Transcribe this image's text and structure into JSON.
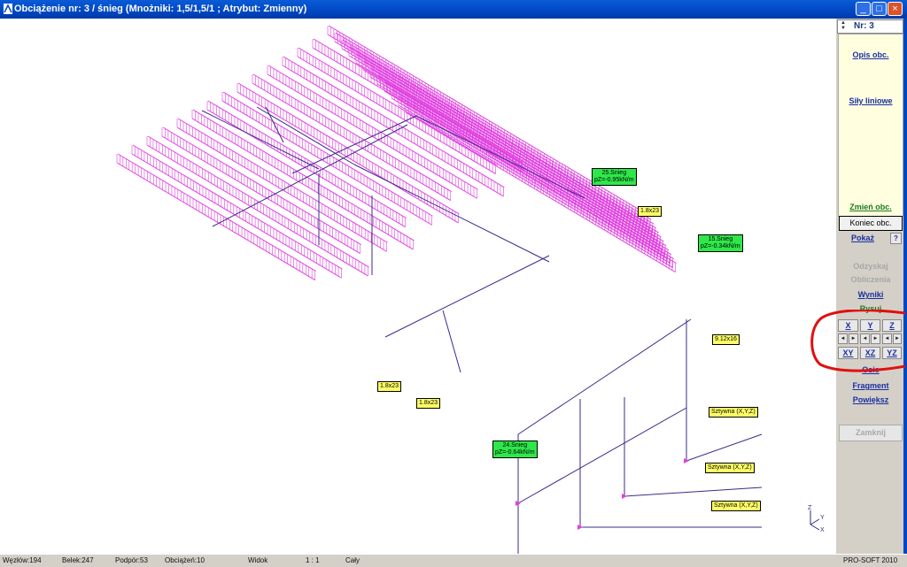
{
  "window": {
    "title": "Obciążenie nr: 3 / śnieg (Mnożniki: 1,5/1,5/1 ; Atrybut: Zmienny)",
    "buttons": {
      "minimize": "_",
      "maximize": "□",
      "close": "×"
    }
  },
  "panel": {
    "nr_label": "Nr: 3",
    "spin": {
      "up": "▲",
      "down": "▼"
    },
    "opis_obc": "Opis obc.",
    "sily_liniowe": "Siły liniowe",
    "zmien_obc": "Zmień obc.",
    "koniec_obc": "Koniec obc.",
    "pokaz": "Pokaż",
    "help": "?",
    "odzyskaj": "Odzyskaj",
    "obliczenia": "Obliczenia",
    "wyniki": "Wyniki",
    "rysuj": "Rysuj",
    "view_axes": [
      "X",
      "Y",
      "Z"
    ],
    "view_planes": [
      "XY",
      "XZ",
      "YZ"
    ],
    "arrows": [
      "◄",
      "►",
      "◄",
      "►",
      "◄",
      "►"
    ],
    "osie": "Osie",
    "fragment": "Fragment",
    "powieksz": "Powiększ",
    "zamknij": "Zamknij"
  },
  "drawing": {
    "labels_yellow": [
      "1.8x23",
      "9.12x16",
      "1.8x23",
      "1.8x23",
      "Sztywna (X,Y,Z)",
      "Sztywna (X,Y,Z)",
      "Sztywna (X,Y,Z)"
    ],
    "labels_green": [
      {
        "line1": "25.Śnieg",
        "line2": "pZ=-0.95kN/m"
      },
      {
        "line1": "15.Śnieg",
        "line2": "pZ=-0.34kN/m"
      },
      {
        "line1": "24.Śnieg",
        "line2": "pZ=-0.64kN/m"
      }
    ],
    "axis_letters": {
      "z": "Z",
      "y": "Y",
      "x": "X"
    },
    "colors": {
      "load": "#e040e0",
      "structure": "#3d2a8a",
      "accent_ring": "#e01010"
    }
  },
  "status": {
    "wezlow": "Węzłów:194",
    "belek": "Belek:247",
    "podpor": "Podpór:53",
    "obciazen": "Obciążeń:10",
    "widok": "Widok",
    "skala": "1 : 1",
    "caly": "Cały",
    "brand": "PRO-SOFT 2010"
  }
}
